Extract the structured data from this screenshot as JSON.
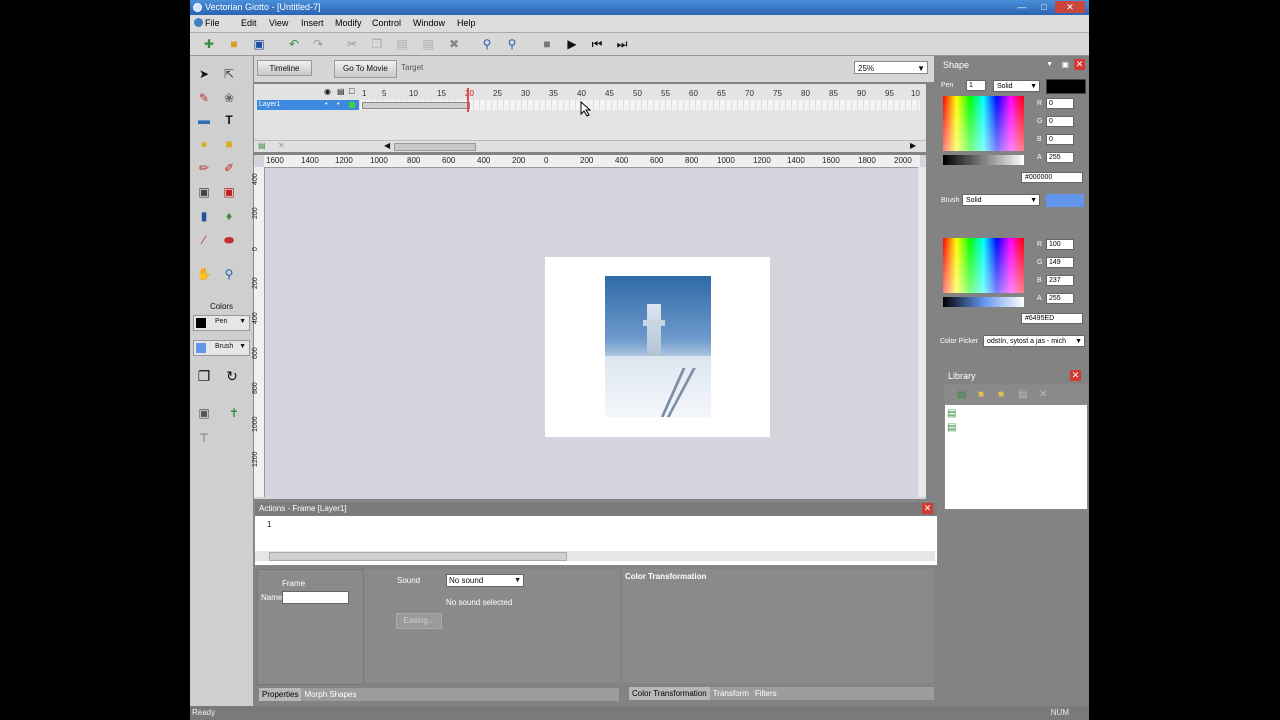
{
  "window": {
    "title": "Vectorian Giotto - [Untitled-7]"
  },
  "menu": [
    {
      "label": "File"
    },
    {
      "label": "Edit"
    },
    {
      "label": "View"
    },
    {
      "label": "Insert"
    },
    {
      "label": "Modify"
    },
    {
      "label": "Control"
    },
    {
      "label": "Window"
    },
    {
      "label": "Help"
    }
  ],
  "tabs": {
    "timeline": "Timeline",
    "go_to_movie": "Go To Movie",
    "target": "Target"
  },
  "zoom": {
    "value": "25%"
  },
  "timeline": {
    "layer_name": "Layer1",
    "frame_ticks": [
      "1",
      "5",
      "10",
      "15",
      "20",
      "25",
      "30",
      "35",
      "40",
      "45",
      "50",
      "55",
      "60",
      "65",
      "70",
      "75",
      "80",
      "85",
      "90",
      "95",
      "10"
    ],
    "current_frame": 20
  },
  "stage": {
    "h_ruler": [
      "1600",
      "1400",
      "1200",
      "1000",
      "800",
      "600",
      "400",
      "200",
      "0",
      "200",
      "400",
      "600",
      "800",
      "1000",
      "1200",
      "1400",
      "1600",
      "1800",
      "2000"
    ],
    "v_ruler": [
      "400",
      "200",
      "0",
      "200",
      "400",
      "600",
      "800",
      "1000",
      "1200"
    ]
  },
  "actions": {
    "title": "Actions - Frame [Layer1]",
    "line_number": "1"
  },
  "properties": {
    "frame_label": "Frame",
    "name_label": "Name",
    "name_value": "",
    "sound_label": "Sound",
    "sound_value": "No sound",
    "sound_status": "No sound selected",
    "easing_button": "Easing...",
    "color_transformation_title": "Color Transformation",
    "left_tabs": [
      "Properties",
      "Morph Shapes"
    ],
    "right_tabs": [
      "Color Transformation",
      "Transform",
      "Filters"
    ]
  },
  "tools": {
    "colors_label": "Colors",
    "pen_label": "Pen",
    "brush_label": "Brush",
    "pen_color": "#000000",
    "brush_color": "#6495ED"
  },
  "shape_panel": {
    "title": "Shape",
    "pen_label": "Pen",
    "pen_width": "1",
    "pen_style": "Solid",
    "pen_rgb": {
      "r": "0",
      "g": "0",
      "b": "0",
      "a": "255"
    },
    "pen_hex": "#000000",
    "brush_label": "Brush",
    "brush_style": "Solid",
    "brush_rgb": {
      "r": "100",
      "g": "149",
      "b": "237",
      "a": "255"
    },
    "brush_hex": "#6495ED",
    "color_picker_label": "Color Picker",
    "color_picker_value": "odstín, sytost a jas - mich"
  },
  "library_panel": {
    "title": "Library"
  },
  "status": {
    "left": "Ready",
    "right": "NUM"
  }
}
